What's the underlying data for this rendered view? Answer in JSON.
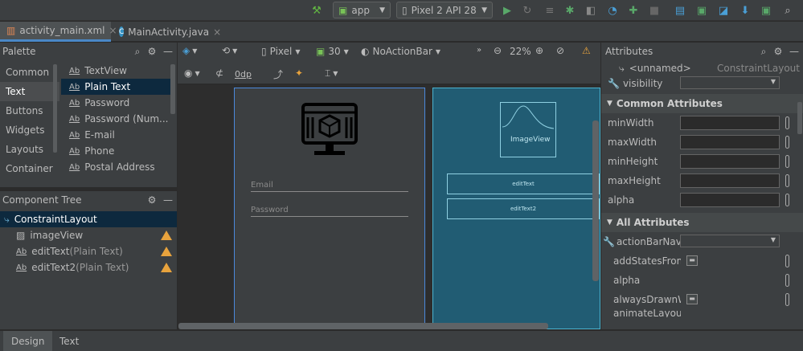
{
  "toolbar": {
    "run_config": "app",
    "device": "Pixel 2 API 28"
  },
  "file_tabs": [
    {
      "label": "activity_main.xml"
    },
    {
      "label": "MainActivity.java"
    }
  ],
  "palette": {
    "title": "Palette",
    "categories": [
      "Common",
      "Text",
      "Buttons",
      "Widgets",
      "Layouts",
      "Container"
    ],
    "items": [
      "TextView",
      "Plain Text",
      "Password",
      "Password (Num...",
      "E-mail",
      "Phone",
      "Postal Address"
    ],
    "item_prefix": "Ab"
  },
  "component_tree": {
    "title": "Component Tree",
    "root": "ConstraintLayout",
    "children": [
      {
        "id": "imageView",
        "type": ""
      },
      {
        "id": "editText",
        "type": "(Plain Text)"
      },
      {
        "id": "editText2",
        "type": "(Plain Text)"
      }
    ]
  },
  "design_toolbar": {
    "device": "Pixel",
    "api": "30",
    "theme": "NoActionBar",
    "zoom": "22%",
    "margin": "0dp"
  },
  "design_view": {
    "email_hint": "Email",
    "password_hint": "Password"
  },
  "blueprint": {
    "image_label": "ImageView",
    "edit1": "editText",
    "edit2": "editText2"
  },
  "attributes": {
    "title": "Attributes",
    "id": "<unnamed>",
    "class": "ConstraintLayout",
    "visibility": "visibility",
    "common_title": "Common Attributes",
    "common": [
      "minWidth",
      "maxWidth",
      "minHeight",
      "maxHeight",
      "alpha"
    ],
    "all_title": "All Attributes",
    "all": [
      "actionBarNavMo",
      "addStatesFromC",
      "alpha",
      "alwaysDrawnWi",
      "animateLayoutC"
    ]
  },
  "bottom_tabs": [
    "Design",
    "Text"
  ]
}
